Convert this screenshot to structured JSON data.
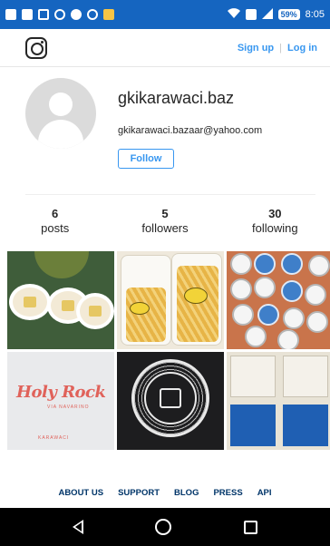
{
  "status_bar": {
    "time": "8:05",
    "battery": "59%",
    "icons": [
      "notification-icons",
      "wifi-icon",
      "signal-icon",
      "battery-icon"
    ]
  },
  "header": {
    "logo": "instagram-logo",
    "sign_up": "Sign up",
    "separator": "|",
    "log_in": "Log in",
    "link_color": "#3897f0"
  },
  "profile": {
    "username": "gkikarawaci.baz",
    "email": "gkikarawaci.bazaar@yahoo.com",
    "follow_label": "Follow"
  },
  "stats": [
    {
      "count": "6",
      "label": "posts"
    },
    {
      "count": "5",
      "label": "followers"
    },
    {
      "count": "30",
      "label": "following"
    }
  ],
  "posts": [
    {
      "alt": "cups"
    },
    {
      "alt": "snacks"
    },
    {
      "alt": "pins"
    },
    {
      "alt": "holy-rock-shirt",
      "text": "Holy Rock",
      "sub": "VIA NAVARINO",
      "footer": "KARAWACI"
    },
    {
      "alt": "seal-shirt"
    },
    {
      "alt": "shirts"
    }
  ],
  "footer": {
    "links": [
      "ABOUT US",
      "SUPPORT",
      "BLOG",
      "PRESS",
      "API"
    ]
  },
  "nav": {
    "icons": [
      "back-icon",
      "home-icon",
      "recents-icon"
    ]
  }
}
